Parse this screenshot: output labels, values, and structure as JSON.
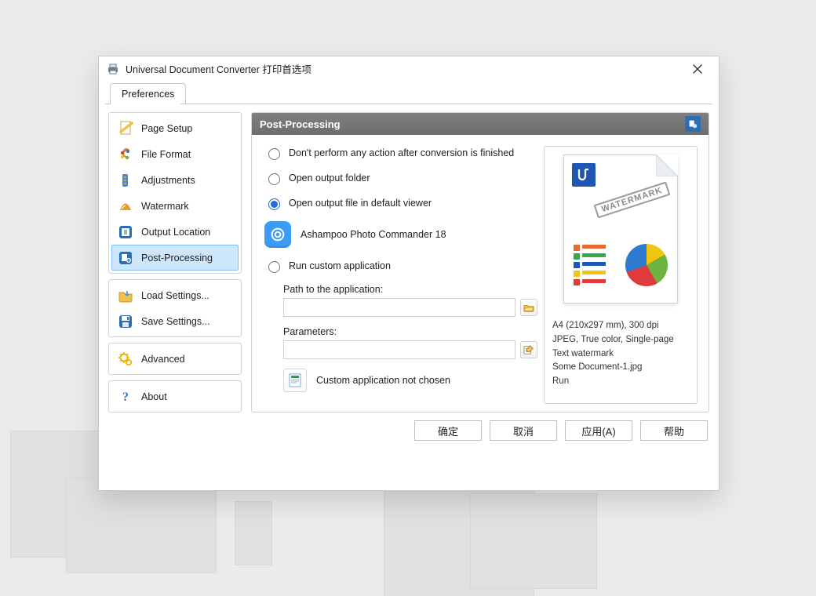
{
  "window": {
    "title": "Universal Document Converter 打印首选项"
  },
  "tab": {
    "preferences": "Preferences"
  },
  "sidebar": {
    "group1": [
      {
        "icon": "page-setup-icon",
        "label": "Page Setup"
      },
      {
        "icon": "file-format-icon",
        "label": "File Format"
      },
      {
        "icon": "adjustments-icon",
        "label": "Adjustments"
      },
      {
        "icon": "watermark-icon",
        "label": "Watermark"
      },
      {
        "icon": "output-location-icon",
        "label": "Output Location"
      },
      {
        "icon": "post-processing-icon",
        "label": "Post-Processing",
        "selected": true
      }
    ],
    "group2": [
      {
        "icon": "load-settings-icon",
        "label": "Load Settings..."
      },
      {
        "icon": "save-settings-icon",
        "label": "Save Settings..."
      }
    ],
    "group3": [
      {
        "icon": "advanced-icon",
        "label": "Advanced"
      }
    ],
    "group4": [
      {
        "icon": "about-icon",
        "label": "About"
      }
    ]
  },
  "panel": {
    "title": "Post-Processing",
    "radios": {
      "none": "Don't perform any action after conversion is finished",
      "folder": "Open output folder",
      "viewer": "Open output file in default viewer",
      "custom": "Run custom application"
    },
    "selected_radio": "viewer",
    "default_viewer": "Ashampoo Photo Commander 18",
    "path_label": "Path to the application:",
    "path_value": "",
    "params_label": "Parameters:",
    "params_value": "",
    "custom_status": "Custom application not chosen"
  },
  "preview": {
    "watermark_text": "WATERMARK",
    "meta": [
      "A4 (210x297 mm), 300 dpi",
      "JPEG, True color, Single-page",
      "Text watermark",
      "Some Document-1.jpg",
      "Run"
    ]
  },
  "buttons": {
    "ok": "确定",
    "cancel": "取消",
    "apply": "应用(A)",
    "help": "帮助"
  }
}
